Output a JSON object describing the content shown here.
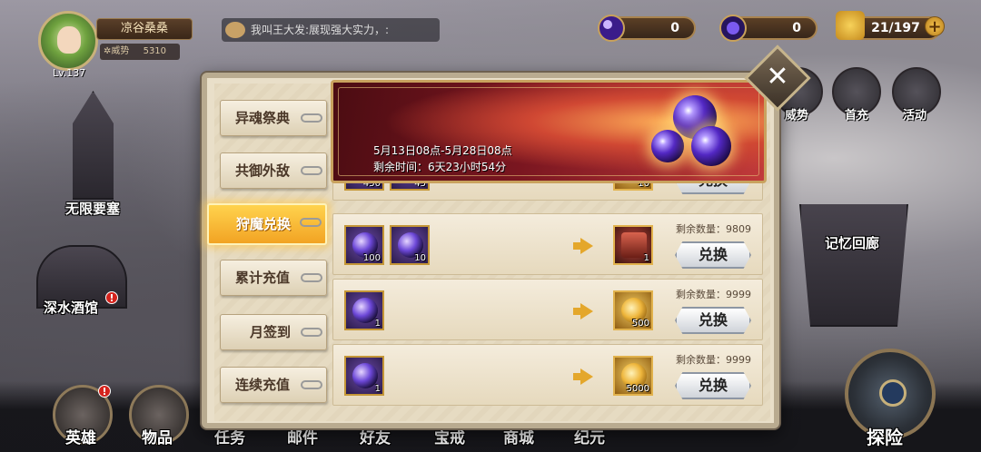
{
  "player": {
    "level": "Lv.137",
    "name": "凉谷桑桑",
    "power_label": "✲威势",
    "power_value": "5310"
  },
  "chat": {
    "message": "我叫王大发:展现强大实力，:"
  },
  "resources": [
    {
      "name": "purple-orb-currency",
      "value": "0"
    },
    {
      "name": "dark-orb-currency",
      "value": "0"
    },
    {
      "name": "stamina",
      "value": "21/197"
    }
  ],
  "side_menu": {
    "power": "威势",
    "first_charge": "首充",
    "activity": "活动"
  },
  "map_labels": {
    "fortress": "无限要塞",
    "tavern": "深水酒馆",
    "memory": "记忆回廊"
  },
  "bottom_nav": [
    {
      "label": "英雄",
      "badge": "!"
    },
    {
      "label": "物品",
      "badge": ""
    },
    {
      "label": "任务",
      "badge": ""
    },
    {
      "label": "邮件",
      "badge": ""
    },
    {
      "label": "好友",
      "badge": ""
    },
    {
      "label": "宝戒",
      "badge": ""
    },
    {
      "label": "商城",
      "badge": ""
    },
    {
      "label": "纪元",
      "badge": ""
    },
    {
      "label": "探险",
      "badge": ""
    }
  ],
  "tavern_badge": "!",
  "dialog": {
    "close_symbol": "✕",
    "tabs": [
      "异魂祭典",
      "共御外敌",
      "狩魔兑换",
      "累计充值",
      "月签到",
      "连续充值"
    ],
    "active_tab": 2,
    "banner": {
      "date": "5月13日08点-5月28日08点",
      "remaining": "剩余时间：6天23小时54分"
    },
    "exchange_label": "兑换",
    "rows": [
      {
        "costs": [
          {
            "type": "purple",
            "qty": "450"
          },
          {
            "type": "orb",
            "qty": "45"
          }
        ],
        "reward": {
          "type": "gold",
          "qty": "10"
        },
        "remaining": ""
      },
      {
        "costs": [
          {
            "type": "purple",
            "qty": "100"
          },
          {
            "type": "orb",
            "qty": "10"
          }
        ],
        "reward": {
          "type": "gift",
          "qty": "1"
        },
        "remaining": "剩余数量：9809"
      },
      {
        "costs": [
          {
            "type": "purple",
            "qty": "1"
          }
        ],
        "reward": {
          "type": "gold",
          "qty": "500"
        },
        "remaining": "剩余数量：9999"
      },
      {
        "costs": [
          {
            "type": "orb",
            "qty": "1"
          }
        ],
        "reward": {
          "type": "gold",
          "qty": "5000"
        },
        "remaining": "剩余数量：9999"
      }
    ]
  }
}
